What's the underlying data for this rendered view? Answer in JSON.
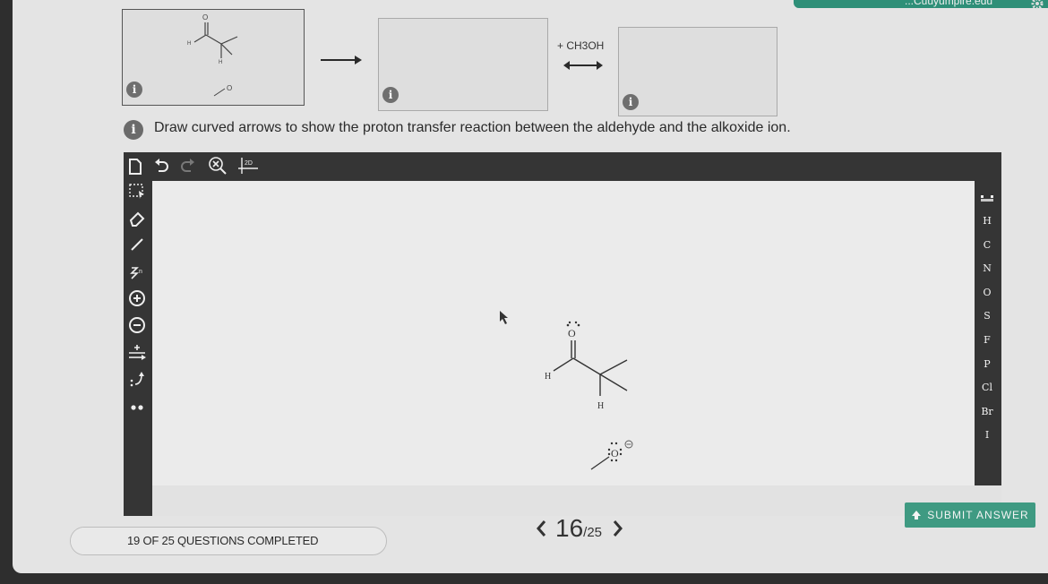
{
  "header": {
    "site_link": "...Cuuyumpire.edu"
  },
  "reaction": {
    "reagent": "+ CH3OH",
    "info_icon_glyph": "i"
  },
  "prompt": "Draw curved arrows to show the proton transfer reaction between the aldehyde and the alkoxide ion.",
  "toolbar": {
    "zoom_label": "2D"
  },
  "element_palette": [
    "H",
    "C",
    "N",
    "O",
    "S",
    "F",
    "P",
    "Cl",
    "Br",
    "I"
  ],
  "molecule_labels": {
    "oxygen": "O",
    "hydrogen_left": "H",
    "hydrogen_bottom": "H",
    "alkoxide_oxygen": "O"
  },
  "footer": {
    "submit_label": "SUBMIT ANSWER",
    "progress_text": "19 OF 25 QUESTIONS COMPLETED",
    "progress_fraction": 0.76,
    "current_question": "16",
    "total_questions": "/25"
  },
  "colors": {
    "accent": "#3f9a82",
    "editor_dark": "#353535",
    "page_bg": "#e4e4e4"
  }
}
